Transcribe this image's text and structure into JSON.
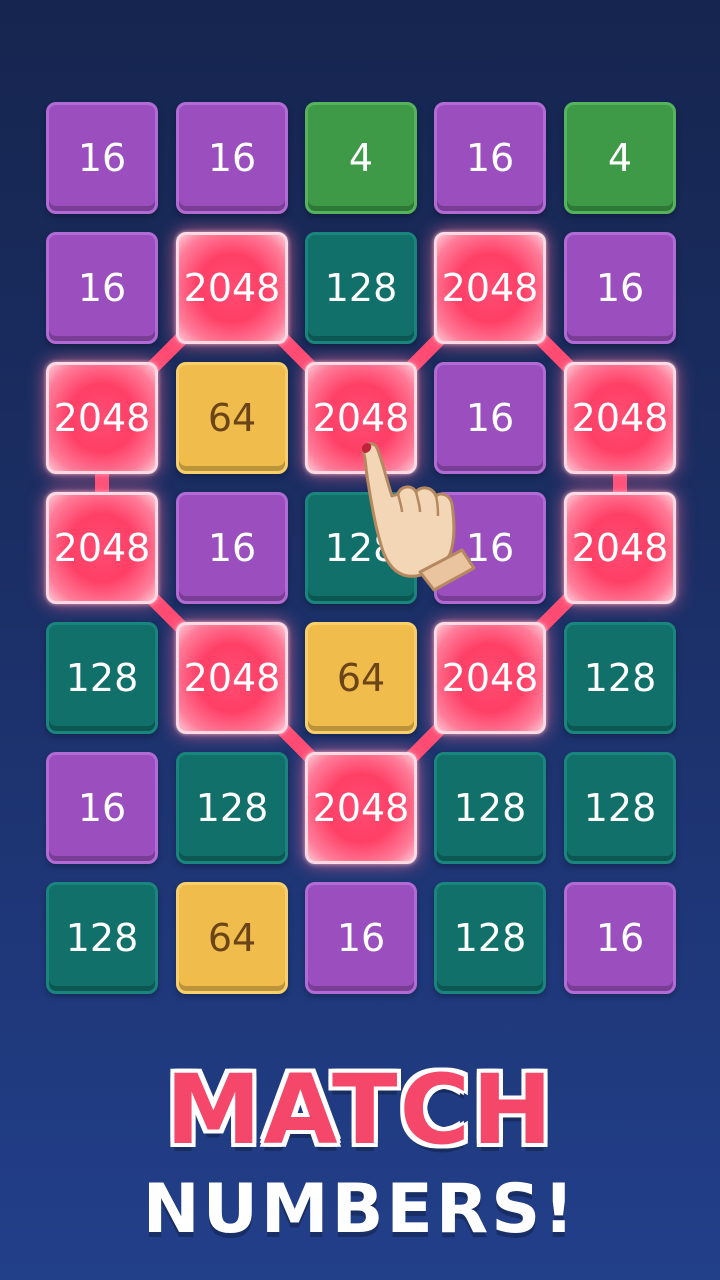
{
  "board": {
    "rows": [
      [
        "16",
        "16",
        "4",
        "16",
        "4"
      ],
      [
        "16",
        "2048",
        "128",
        "2048",
        "16"
      ],
      [
        "2048",
        "64",
        "2048",
        "16",
        "2048"
      ],
      [
        "2048",
        "16",
        "128",
        "16",
        "2048"
      ],
      [
        "128",
        "2048",
        "64",
        "2048",
        "128"
      ],
      [
        "16",
        "128",
        "2048",
        "128",
        "128"
      ],
      [
        "128",
        "64",
        "16",
        "128",
        "16"
      ]
    ],
    "connection_path": [
      [
        1,
        1
      ],
      [
        2,
        0
      ],
      [
        3,
        0
      ],
      [
        4,
        1
      ],
      [
        5,
        2
      ],
      [
        4,
        3
      ],
      [
        3,
        4
      ],
      [
        2,
        4
      ],
      [
        1,
        3
      ],
      [
        2,
        2
      ],
      [
        1,
        1
      ]
    ]
  },
  "colors": {
    "tile_16": "#9b4fbf",
    "tile_4": "#3e9a47",
    "tile_128": "#117069",
    "tile_64": "#f0bd4c",
    "tile_2048": "#ff4c73",
    "connector": "#ff4c73",
    "title_match": "#f4476a",
    "title_numbers": "#ffffff"
  },
  "pointer": {
    "icon": "pointing-hand-icon"
  },
  "title": {
    "line1": "MATCH",
    "line2": "NUMBERS!"
  }
}
